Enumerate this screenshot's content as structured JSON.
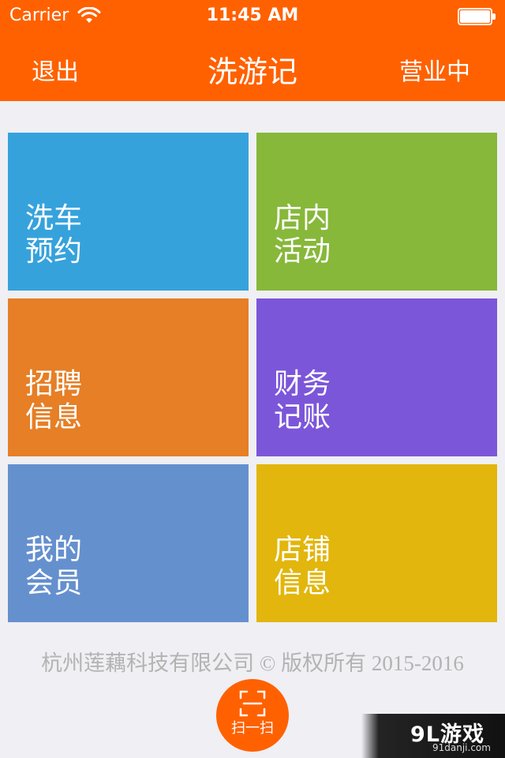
{
  "status_bar": {
    "carrier": "Carrier",
    "time": "11:45 AM",
    "wifi_icon": "wifi-icon",
    "battery_icon": "battery-icon",
    "battery_level": 1.0
  },
  "nav": {
    "left_label": "退出",
    "title": "洗游记",
    "right_label": "营业中"
  },
  "tiles": [
    {
      "line1": "洗车",
      "line2": "预约",
      "color": "#36a2dc"
    },
    {
      "line1": "店内",
      "line2": "活动",
      "color": "#87b83a"
    },
    {
      "line1": "招聘",
      "line2": "信息",
      "color": "#e67f26"
    },
    {
      "line1": "财务",
      "line2": "记账",
      "color": "#7c56d9"
    },
    {
      "line1": "我的",
      "line2": "会员",
      "color": "#6590ce"
    },
    {
      "line1": "店铺",
      "line2": "信息",
      "color": "#e2b60c"
    }
  ],
  "footer": {
    "copyright": "杭州莲藕科技有限公司 © 版权所有 2015-2016"
  },
  "scan_button": {
    "label": "扫一扫",
    "icon": "scan-frame-icon"
  },
  "watermark": {
    "logo_text": "9L游戏",
    "url": "91danji.com"
  },
  "colors": {
    "brand": "#ff6100",
    "background": "#efeff4",
    "footer_text": "#b3b3b3"
  }
}
